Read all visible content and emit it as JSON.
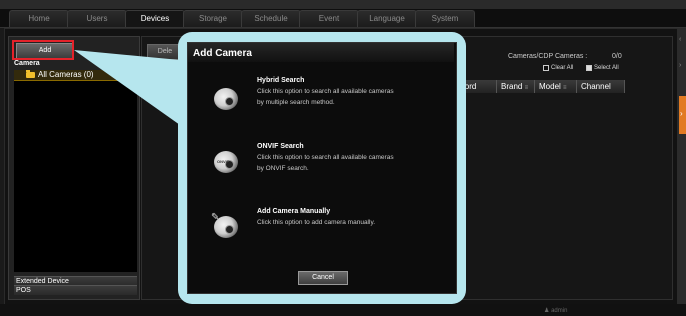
{
  "nav": {
    "tabs": [
      {
        "label": "Home"
      },
      {
        "label": "Users"
      },
      {
        "label": "Devices"
      },
      {
        "label": "Storage"
      },
      {
        "label": "Schedule"
      },
      {
        "label": "Event"
      },
      {
        "label": "Language"
      },
      {
        "label": "System"
      }
    ],
    "active_tab": "Devices"
  },
  "sidebar": {
    "add_label": "Add",
    "camera_header": "Camera",
    "tree_root": "All Cameras (0)",
    "extended_device": "Extended Device",
    "pos": "POS"
  },
  "main": {
    "delete_label": "Dele",
    "cameras_label": "Cameras/CDP Cameras :",
    "cameras_count": "0/0",
    "clear_all_label": "Clear All",
    "select_all_label": "Select All",
    "columns": [
      {
        "label": "word"
      },
      {
        "label": "Brand"
      },
      {
        "label": "Model"
      },
      {
        "label": "Channel"
      }
    ],
    "sort_glyph": "≡"
  },
  "modal": {
    "title": "Add Camera",
    "options": [
      {
        "title": "Hybrid Search",
        "desc": "Click this option to search all available cameras by multiple search method.",
        "icon": "camera-search-icon"
      },
      {
        "title": "ONVIF Search",
        "desc": "Click this option to search all available cameras by ONVIF search.",
        "icon": "onvif-camera-icon"
      },
      {
        "title": "Add Camera Manually",
        "desc": "Click this option to add camera manually.",
        "icon": "camera-wrench-icon"
      }
    ],
    "onvif_badge": "ONVIF",
    "cancel_label": "Cancel"
  },
  "status": {
    "user": "admin"
  },
  "colors": {
    "accent": "#e27a22",
    "highlight": "#e4222a",
    "callout": "#b6e6ee"
  }
}
